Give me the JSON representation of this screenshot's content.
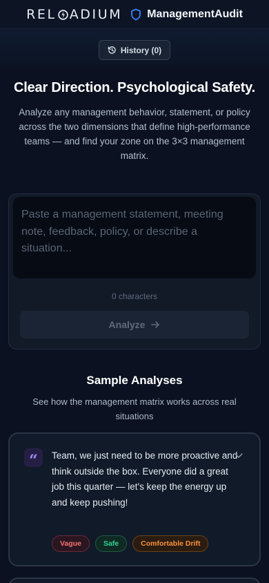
{
  "header": {
    "brand_pre": "REL",
    "brand_post": "ADIUM",
    "app_name": "ManagementAudit"
  },
  "history_button": {
    "label": "History (0)"
  },
  "hero": {
    "title": "Clear Direction. Psychological Safety.",
    "subtitle": "Analyze any management behavior, statement, or policy across the two dimensions that define high-performance teams — and find your zone on the 3×3 management matrix."
  },
  "input": {
    "placeholder": "Paste a management statement, meeting note, feedback, policy, or describe a situation...",
    "char_count": "0 characters",
    "analyze_label": "Analyze"
  },
  "samples": {
    "title": "Sample Analyses",
    "subtitle": "See how the management matrix works across real situations",
    "items": [
      {
        "quote": "Team, we just need to be more proactive and think outside the box. Everyone did a great job this quarter — let's keep the energy up and keep pushing!",
        "tags": [
          "Vague",
          "Safe",
          "Comfortable Drift"
        ]
      }
    ]
  },
  "colors": {
    "background": "#0b1120",
    "accent_blue": "#3b82f6",
    "quote_purple": "#a78bfa",
    "tag_red": "#f87171",
    "tag_green": "#34d399",
    "tag_orange": "#fb923c"
  },
  "icons": [
    "reload-o-icon",
    "shield-icon",
    "history-icon",
    "arrow-right-icon",
    "quote-icon",
    "chevron-down-icon"
  ]
}
